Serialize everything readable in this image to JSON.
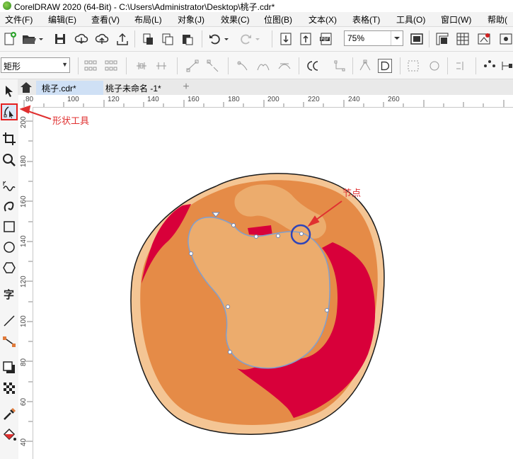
{
  "window": {
    "title": "CorelDRAW 2020 (64-Bit) - C:\\Users\\Administrator\\Desktop\\桃子.cdr*"
  },
  "menu": {
    "items": [
      "文件(F)",
      "编辑(E)",
      "查看(V)",
      "布局(L)",
      "对象(J)",
      "效果(C)",
      "位图(B)",
      "文本(X)",
      "表格(T)",
      "工具(O)",
      "窗口(W)",
      "帮助("
    ]
  },
  "toolbar": {
    "zoom_value": "75%"
  },
  "property_bar": {
    "object_type": "矩形"
  },
  "tabs": {
    "items": [
      {
        "label": "桃子.cdr*",
        "active": true
      },
      {
        "label": "桃子未命名 -1*",
        "active": false
      }
    ],
    "add_label": "+"
  },
  "rulers": {
    "horizontal": [
      "80",
      "100",
      "120",
      "140",
      "160",
      "180",
      "200",
      "220",
      "240",
      "260"
    ],
    "vertical": [
      "200",
      "180",
      "160",
      "140",
      "120",
      "100",
      "80",
      "60",
      "40"
    ]
  },
  "toolbox": {
    "tools": [
      "pick-tool-icon",
      "shape-tool-icon",
      "crop-tool-icon",
      "zoom-tool-icon",
      "freehand-tool-icon",
      "artistic-media-icon",
      "rectangle-tool-icon",
      "ellipse-tool-icon",
      "polygon-tool-icon",
      "text-tool-icon",
      "dimension-tool-icon",
      "connector-tool-icon",
      "drop-shadow-icon",
      "transparency-icon",
      "eyedropper-icon",
      "interactive-fill-icon"
    ],
    "active_tool": "shape-tool-icon"
  },
  "annotations": {
    "shape_tool_label": "形状工具",
    "node_label": "节点"
  },
  "colors": {
    "peach_outline": "#1a1a1a",
    "peach_rim": "#f4c594",
    "peach_body": "#e58b47",
    "peach_red": "#d8003a",
    "peach_light": "#ecac6d",
    "selection_path": "#7f9fcf",
    "highlight_circle": "#2f45b8",
    "annotation_red": "#e03030"
  }
}
